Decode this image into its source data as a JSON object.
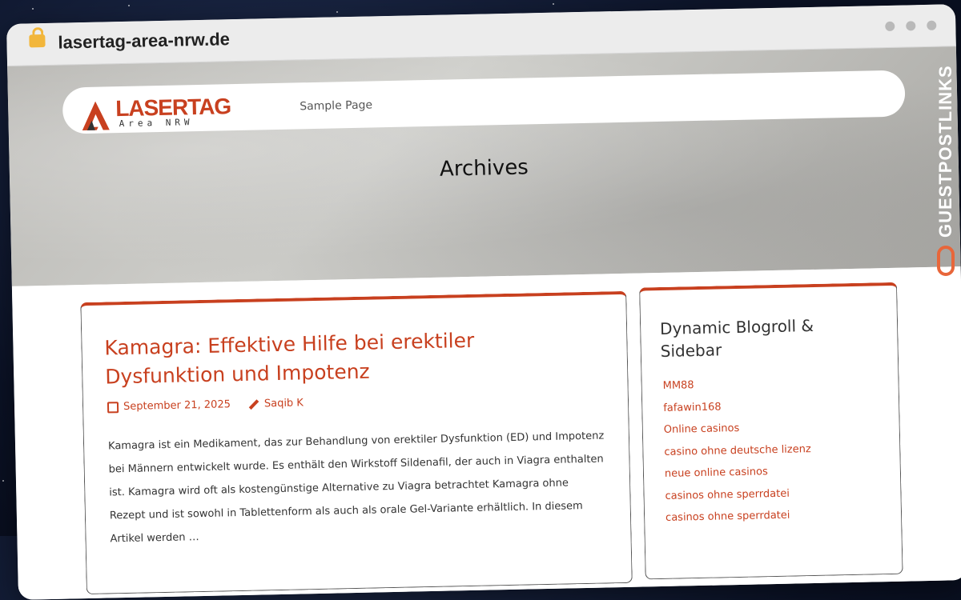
{
  "browser": {
    "url": "lasertag-area-nrw.de"
  },
  "site": {
    "logo": {
      "title": "LASERTAG",
      "subtitle": "Area NRW"
    },
    "nav": [
      {
        "label": "Sample Page"
      }
    ]
  },
  "hero": {
    "title": "Archives"
  },
  "post": {
    "title": "Kamagra: Effektive Hilfe bei erektiler Dysfunktion und Impotenz",
    "date": "September 21, 2025",
    "author": "Saqib K",
    "excerpt": "Kamagra ist ein Medikament, das zur Behandlung von erektiler Dysfunktion (ED) und Impotenz bei Männern entwickelt wurde. Es enthält den Wirkstoff Sildenafil, der auch in Viagra enthalten ist. Kamagra wird oft als kostengünstige Alternative zu Viagra betrachtet Kamagra ohne Rezept und ist sowohl in Tablettenform als auch als orale Gel-Variante erhältlich. In diesem Artikel werden …"
  },
  "sidebar": {
    "title": "Dynamic Blogroll & Sidebar",
    "links": [
      "MM88",
      "fafawin168",
      "Online casinos",
      "casino ohne deutsche lizenz",
      "neue online casinos",
      "casinos ohne sperrdatei",
      "casinos ohne sperrdatei"
    ]
  },
  "watermark": {
    "text": "GUESTPOSTLINKS"
  },
  "colors": {
    "accent": "#c8401f",
    "watermark_icon": "#e8663a"
  }
}
